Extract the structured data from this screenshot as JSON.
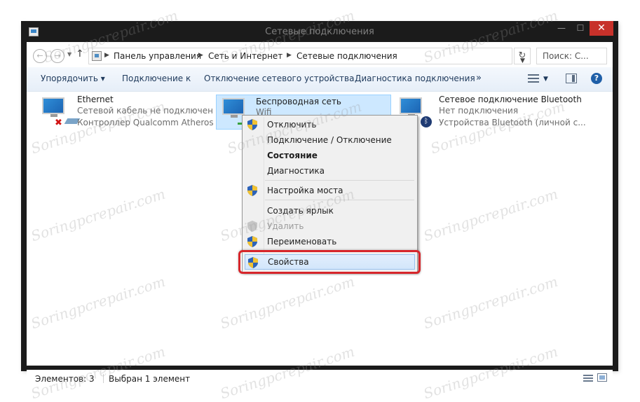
{
  "window": {
    "title": "Сетевые подключения",
    "buttons": {
      "minimize": "—",
      "maximize": "☐",
      "close": "✕"
    }
  },
  "addressbar": {
    "back": "←",
    "forward": "→",
    "up": "↑",
    "crumbs": [
      "Панель управления",
      "Сеть и Интернет",
      "Сетевые подключения"
    ],
    "separator": "▶",
    "dropdown": "▼",
    "refresh": "↻",
    "search_placeholder": "Поиск: С..."
  },
  "toolbar": {
    "organize": "Упорядочить ▾",
    "connect": "Подключение к",
    "disable": "Отключение сетевого устройства",
    "diagnose": "Диагностика подключения",
    "more": "»",
    "view_drop": "▼",
    "help": "?"
  },
  "connections": [
    {
      "name": "Ethernet",
      "line1": "Сетевой кабель не подключен",
      "line2": "Контроллер Qualcomm Atheros ...",
      "status_icon": "red-x-icon"
    },
    {
      "name": "Беспроводная сеть",
      "line1": "Wifi",
      "line2": "",
      "status_icon": "wifi-signal-icon",
      "selected": true
    },
    {
      "name": "Сетевое подключение Bluetooth",
      "line1": "Нет подключения",
      "line2": "Устройства Bluetooth (личной с...",
      "status_icon": "bluetooth-icon",
      "bt_glyph": "ᛒ"
    }
  ],
  "context_menu": {
    "items": [
      {
        "label": "Отключить",
        "shield": true
      },
      {
        "label": "Подключение / Отключение",
        "shield": false
      },
      {
        "label": "Состояние",
        "shield": false,
        "bold": true
      },
      {
        "label": "Диагностика",
        "shield": false
      },
      {
        "label": "Настройка моста",
        "shield": true
      },
      {
        "label": "Создать ярлык",
        "shield": false
      },
      {
        "label": "Удалить",
        "shield": true,
        "disabled": true
      },
      {
        "label": "Переименовать",
        "shield": true
      },
      {
        "label": "Свойства",
        "shield": true,
        "highlighted": true
      }
    ]
  },
  "statusbar": {
    "count": "Элементов: 3",
    "selected": "Выбран 1 элемент"
  },
  "watermark": "Soringpcrepair.com",
  "colors": {
    "close_button": "#c7312a",
    "highlight_outline": "#d7262b",
    "selection": "#cde8ff"
  }
}
